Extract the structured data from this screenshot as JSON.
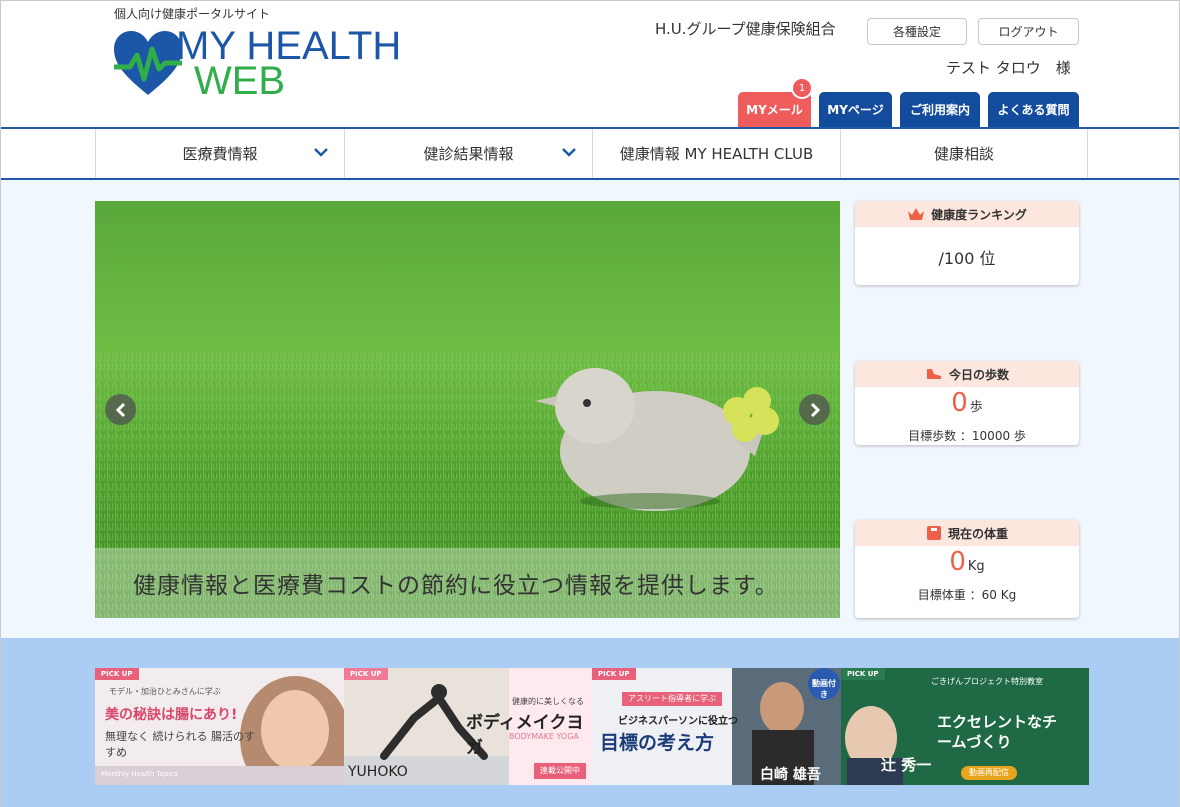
{
  "header": {
    "tagline": "個人向け健康ポータルサイト",
    "logo_line1": "MY HEALTH",
    "logo_line2": "WEB",
    "org_name": "H.U.グループ健康保険組合",
    "settings_label": "各種設定",
    "logout_label": "ログアウト",
    "user_name": "テスト タロウ　様",
    "tabs": [
      {
        "label": "MYメール",
        "badge": "1"
      },
      {
        "label": "MYページ"
      },
      {
        "label": "ご利用案内"
      },
      {
        "label": "よくある質問"
      }
    ]
  },
  "nav": {
    "items": [
      {
        "label": "医療費情報"
      },
      {
        "label": "健診結果情報"
      },
      {
        "label": "健康情報 MY HEALTH CLUB"
      },
      {
        "label": "健康相談"
      }
    ]
  },
  "slider": {
    "caption": "健康情報と医療費コストの節約に役立つ情報を提供します。"
  },
  "widgets": {
    "ranking": {
      "title": "健康度ランキング",
      "value": "/100 位"
    },
    "steps": {
      "title": "今日の歩数",
      "value": "0",
      "unit": "歩",
      "target": "目標歩数 ：10000 歩"
    },
    "weight": {
      "title": "現在の体重",
      "value": "0",
      "unit": "Kg",
      "target": "目標体重 ：60 Kg"
    }
  },
  "banners": [
    {
      "pick": "PICK UP",
      "title": "美の秘訣は腸にあり!",
      "sub": "モデル・加治ひとみさんに学ぶ",
      "line2": "無理なく 続けられる 腸活のすすめ",
      "foot": "Monthly Health Topics"
    },
    {
      "pick": "PICK UP",
      "title": "ボディメイクヨガ",
      "sub": "健康的に美しくなる",
      "line2": "BODYMAKE YOGA",
      "foot": "YUHOKO",
      "tag": "連載公開中"
    },
    {
      "pick": "PICK UP",
      "title": "目標の考え方",
      "sub": "ビジネスパーソンに役立つ",
      "line2": "アスリート指導者に学ぶ",
      "foot": "白崎 雄吾",
      "tag": "動画付き"
    },
    {
      "pick": "PICK UP",
      "title": "エクセレントなチームづくり",
      "sub": "ごきげんプロジェクト特別教室",
      "line2": "辻 秀一",
      "foot": "動画再配信"
    }
  ],
  "colors": {
    "brand_blue": "#134c9c",
    "mail_red": "#ee5c5c",
    "accent_orange": "#ef6048",
    "logo_green": "#2fae49"
  }
}
